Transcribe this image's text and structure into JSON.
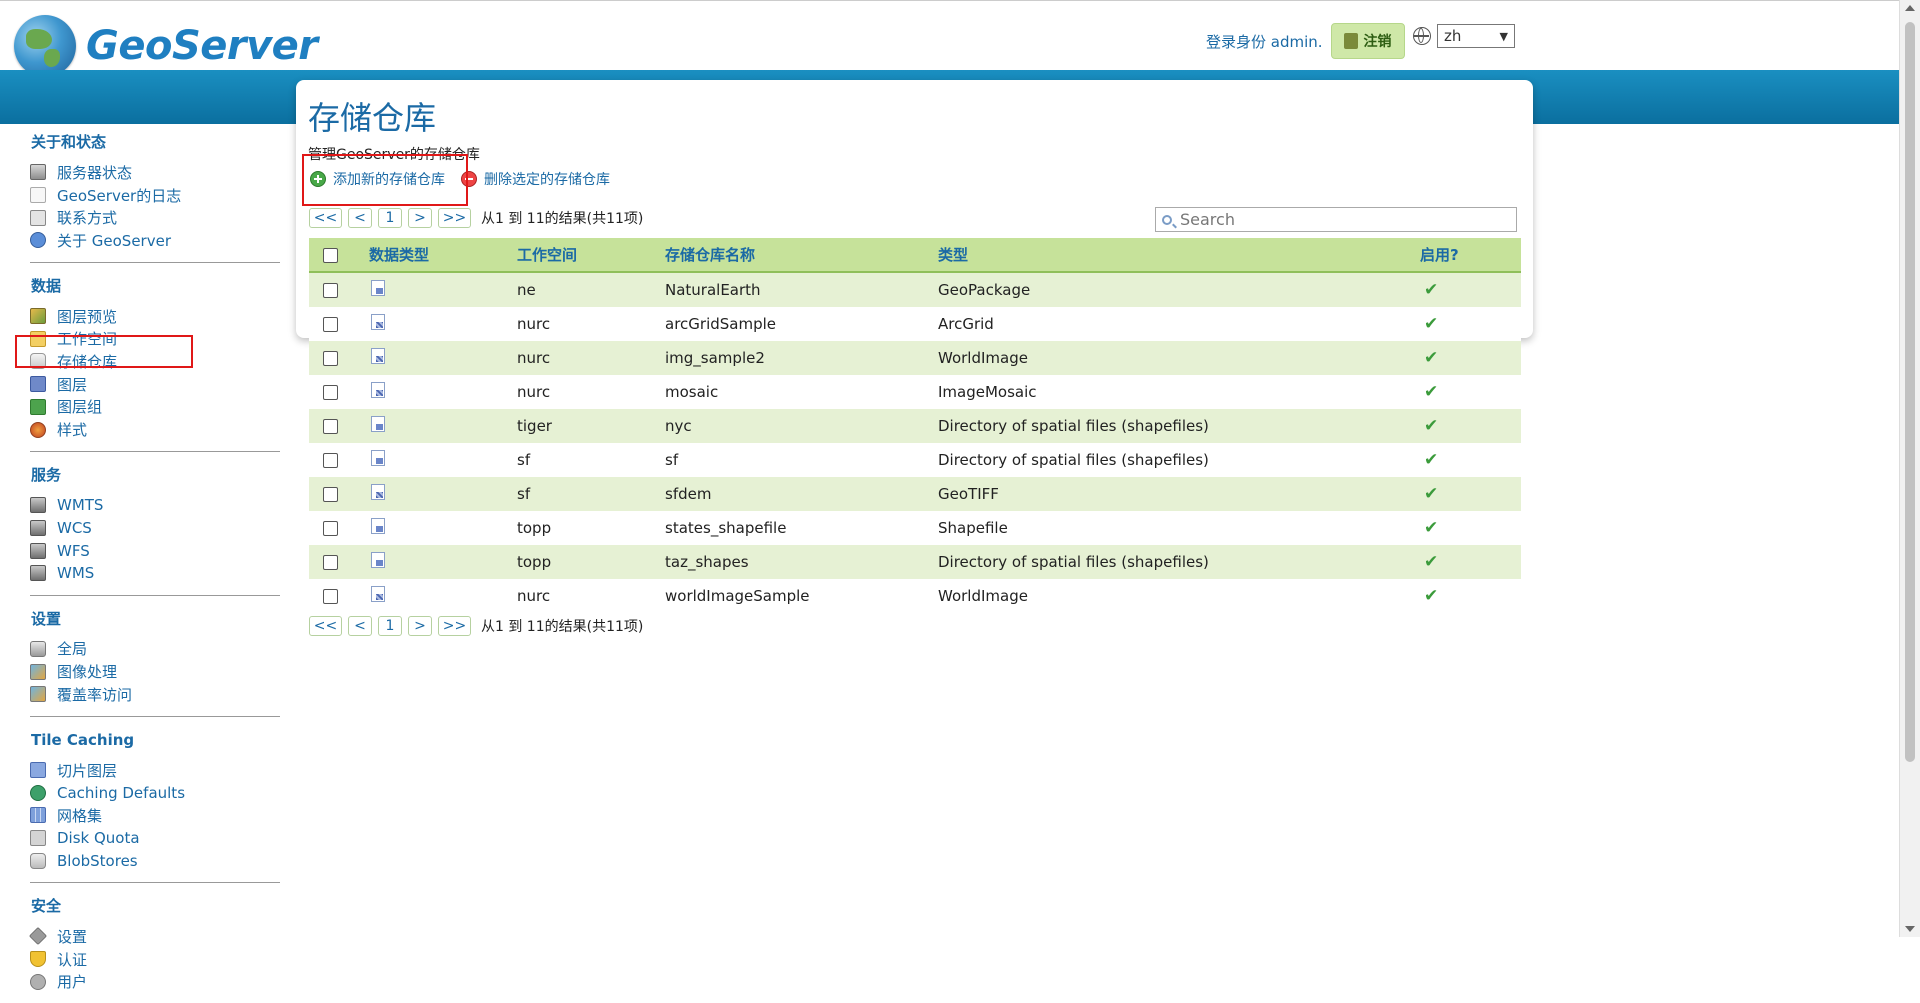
{
  "header": {
    "logo_text": "GeoServer",
    "login_text": "登录身份 admin.",
    "logout_label": "注销",
    "language": "zh"
  },
  "sidebar": {
    "sections": [
      {
        "heading": "关于和状态",
        "items": [
          {
            "label": "服务器状态",
            "icon": "server-status-icon"
          },
          {
            "label": "GeoServer的日志",
            "icon": "log-icon"
          },
          {
            "label": "联系方式",
            "icon": "contact-icon"
          },
          {
            "label": "关于 GeoServer",
            "icon": "about-icon"
          }
        ]
      },
      {
        "heading": "数据",
        "items": [
          {
            "label": "图层预览",
            "icon": "layer-preview-icon"
          },
          {
            "label": "工作空间",
            "icon": "workspace-icon"
          },
          {
            "label": "存储仓库",
            "icon": "store-icon"
          },
          {
            "label": "图层",
            "icon": "layer-icon"
          },
          {
            "label": "图层组",
            "icon": "layer-group-icon"
          },
          {
            "label": "样式",
            "icon": "style-icon"
          }
        ]
      },
      {
        "heading": "服务",
        "items": [
          {
            "label": "WMTS",
            "icon": "wmts-icon"
          },
          {
            "label": "WCS",
            "icon": "wcs-icon"
          },
          {
            "label": "WFS",
            "icon": "wfs-icon"
          },
          {
            "label": "WMS",
            "icon": "wms-icon"
          }
        ]
      },
      {
        "heading": "设置",
        "items": [
          {
            "label": "全局",
            "icon": "global-settings-icon"
          },
          {
            "label": "图像处理",
            "icon": "image-processing-icon"
          },
          {
            "label": "覆盖率访问",
            "icon": "coverage-access-icon"
          }
        ]
      },
      {
        "heading": "Tile Caching",
        "items": [
          {
            "label": "切片图层",
            "icon": "tile-layers-icon"
          },
          {
            "label": "Caching Defaults",
            "icon": "caching-defaults-icon"
          },
          {
            "label": "网格集",
            "icon": "gridsets-icon"
          },
          {
            "label": "Disk Quota",
            "icon": "disk-quota-icon"
          },
          {
            "label": "BlobStores",
            "icon": "blobstores-icon"
          }
        ]
      },
      {
        "heading": "安全",
        "items": [
          {
            "label": "设置",
            "icon": "security-settings-icon"
          },
          {
            "label": "认证",
            "icon": "authentication-icon"
          },
          {
            "label": "用户",
            "icon": "users-icon"
          }
        ]
      }
    ]
  },
  "main": {
    "title": "存储仓库",
    "description": "管理GeoServer的存储仓库",
    "add_label": "添加新的存储仓库",
    "remove_label": "删除选定的存储仓库",
    "pager": {
      "first": "<<",
      "prev": "<",
      "page": "1",
      "next": ">",
      "last": ">>",
      "info": "从1 到 11的结果(共11项)"
    },
    "search_placeholder": "Search",
    "table": {
      "headers": {
        "data_type": "数据类型",
        "workspace": "工作空间",
        "store_name": "存储仓库名称",
        "type": "类型",
        "enabled": "启用?"
      },
      "rows": [
        {
          "kind": "vector",
          "workspace": "ne",
          "name": "NaturalEarth",
          "type": "GeoPackage",
          "enabled": true
        },
        {
          "kind": "raster",
          "workspace": "nurc",
          "name": "arcGridSample",
          "type": "ArcGrid",
          "enabled": true
        },
        {
          "kind": "raster",
          "workspace": "nurc",
          "name": "img_sample2",
          "type": "WorldImage",
          "enabled": true
        },
        {
          "kind": "raster",
          "workspace": "nurc",
          "name": "mosaic",
          "type": "ImageMosaic",
          "enabled": true
        },
        {
          "kind": "vector",
          "workspace": "tiger",
          "name": "nyc",
          "type": "Directory of spatial files (shapefiles)",
          "enabled": true
        },
        {
          "kind": "vector",
          "workspace": "sf",
          "name": "sf",
          "type": "Directory of spatial files (shapefiles)",
          "enabled": true
        },
        {
          "kind": "raster",
          "workspace": "sf",
          "name": "sfdem",
          "type": "GeoTIFF",
          "enabled": true
        },
        {
          "kind": "vector",
          "workspace": "topp",
          "name": "states_shapefile",
          "type": "Shapefile",
          "enabled": true
        },
        {
          "kind": "vector",
          "workspace": "topp",
          "name": "taz_shapes",
          "type": "Directory of spatial files (shapefiles)",
          "enabled": true
        },
        {
          "kind": "raster",
          "workspace": "nurc",
          "name": "worldImageSample",
          "type": "WorldImage",
          "enabled": true
        }
      ]
    }
  },
  "colors": {
    "brand_blue": "#1b6aa5",
    "band_blue": "#0b6f9f",
    "table_header": "#c6e29a",
    "row_odd": "#e6f1d4",
    "highlight_red": "#e01818"
  }
}
